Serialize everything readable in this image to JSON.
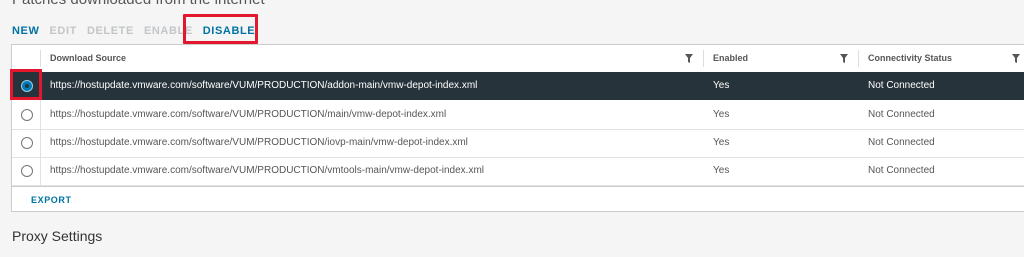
{
  "section": {
    "title": "Patches downloaded from the internet"
  },
  "toolbar": {
    "new_label": "NEW",
    "edit_label": "EDIT",
    "delete_label": "DELETE",
    "enable_label": "ENABLE",
    "disable_label": "DISABLE"
  },
  "grid": {
    "columns": [
      "Download Source",
      "Enabled",
      "Connectivity Status"
    ],
    "rows": [
      {
        "source": "https://hostupdate.vmware.com/software/VUM/PRODUCTION/addon-main/vmw-depot-index.xml",
        "enabled": "Yes",
        "status": "Not Connected",
        "selected": true
      },
      {
        "source": "https://hostupdate.vmware.com/software/VUM/PRODUCTION/main/vmw-depot-index.xml",
        "enabled": "Yes",
        "status": "Not Connected",
        "selected": false
      },
      {
        "source": "https://hostupdate.vmware.com/software/VUM/PRODUCTION/iovp-main/vmw-depot-index.xml",
        "enabled": "Yes",
        "status": "Not Connected",
        "selected": false
      },
      {
        "source": "https://hostupdate.vmware.com/software/VUM/PRODUCTION/vmtools-main/vmw-depot-index.xml",
        "enabled": "Yes",
        "status": "Not Connected",
        "selected": false
      }
    ],
    "export_label": "EXPORT"
  },
  "proxy": {
    "title": "Proxy Settings"
  },
  "colors": {
    "accent": "#0072a3",
    "selected_row": "#27333b",
    "highlight": "#e3172d",
    "disabled_text": "#c3c6c8"
  },
  "icons": {
    "filter": "filter-icon",
    "radio": "radio-button"
  }
}
